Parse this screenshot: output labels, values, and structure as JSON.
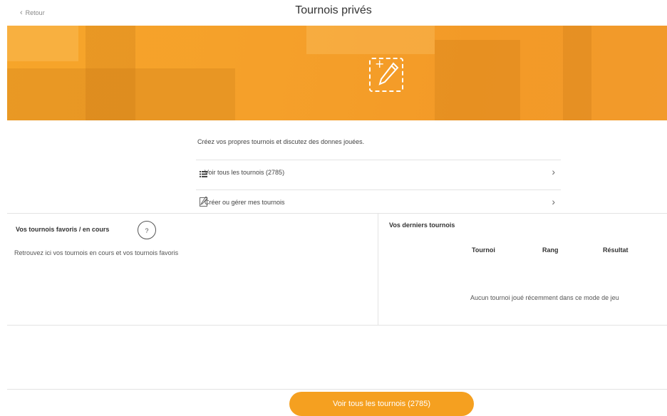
{
  "header": {
    "back_label": "Retour",
    "title": "Tournois privés"
  },
  "intro": "Créez vos propres tournois et discutez des donnes jouées.",
  "menu": [
    {
      "label": "Voir tous les tournois (2785)",
      "icon": "list-icon"
    },
    {
      "label": "Créer ou gérer mes tournois",
      "icon": "edit-icon"
    }
  ],
  "favorites": {
    "title": "Vos tournois favoris / en cours",
    "help": "?",
    "description": "Retrouvez ici vos tournois en cours et vos tournois favoris"
  },
  "recent": {
    "title": "Vos derniers tournois",
    "columns": [
      "Tournoi",
      "Rang",
      "Résultat"
    ],
    "empty_message": "Aucun tournoi joué récemment dans ce mode de jeu"
  },
  "footer": {
    "cta_label": "Voir tous les tournois (2785)"
  },
  "colors": {
    "accent": "#f5a020",
    "banner": "#f6a52a"
  }
}
